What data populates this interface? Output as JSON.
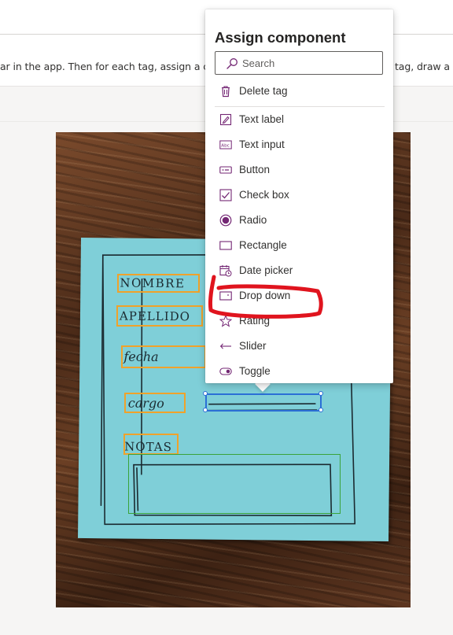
{
  "instruction": {
    "left_text": "ar in the app. Then for each tag, assign a c",
    "right_text": "tag, draw a"
  },
  "photo": {
    "tags": [
      "NOMBRE",
      "APELLIDO",
      "fecha",
      "cargo",
      "NOTAS"
    ]
  },
  "popup": {
    "title": "Assign component",
    "search_placeholder": "Search",
    "delete_label": "Delete tag",
    "items": [
      {
        "label": "Text label",
        "icon": "text-label-icon"
      },
      {
        "label": "Text input",
        "icon": "text-input-icon"
      },
      {
        "label": "Button",
        "icon": "button-icon"
      },
      {
        "label": "Check box",
        "icon": "checkbox-icon"
      },
      {
        "label": "Radio",
        "icon": "radio-icon"
      },
      {
        "label": "Rectangle",
        "icon": "rectangle-icon"
      },
      {
        "label": "Date picker",
        "icon": "date-picker-icon"
      },
      {
        "label": "Drop down",
        "icon": "dropdown-icon"
      },
      {
        "label": "Rating",
        "icon": "star-icon"
      },
      {
        "label": "Slider",
        "icon": "slider-icon"
      },
      {
        "label": "Toggle",
        "icon": "toggle-icon"
      }
    ]
  },
  "colors": {
    "accent": "#742774",
    "tag_orange": "#f0a22a",
    "tag_green": "#3aa33a",
    "selected_blue": "#2b6fd6",
    "annotation_red": "#e0141e"
  }
}
